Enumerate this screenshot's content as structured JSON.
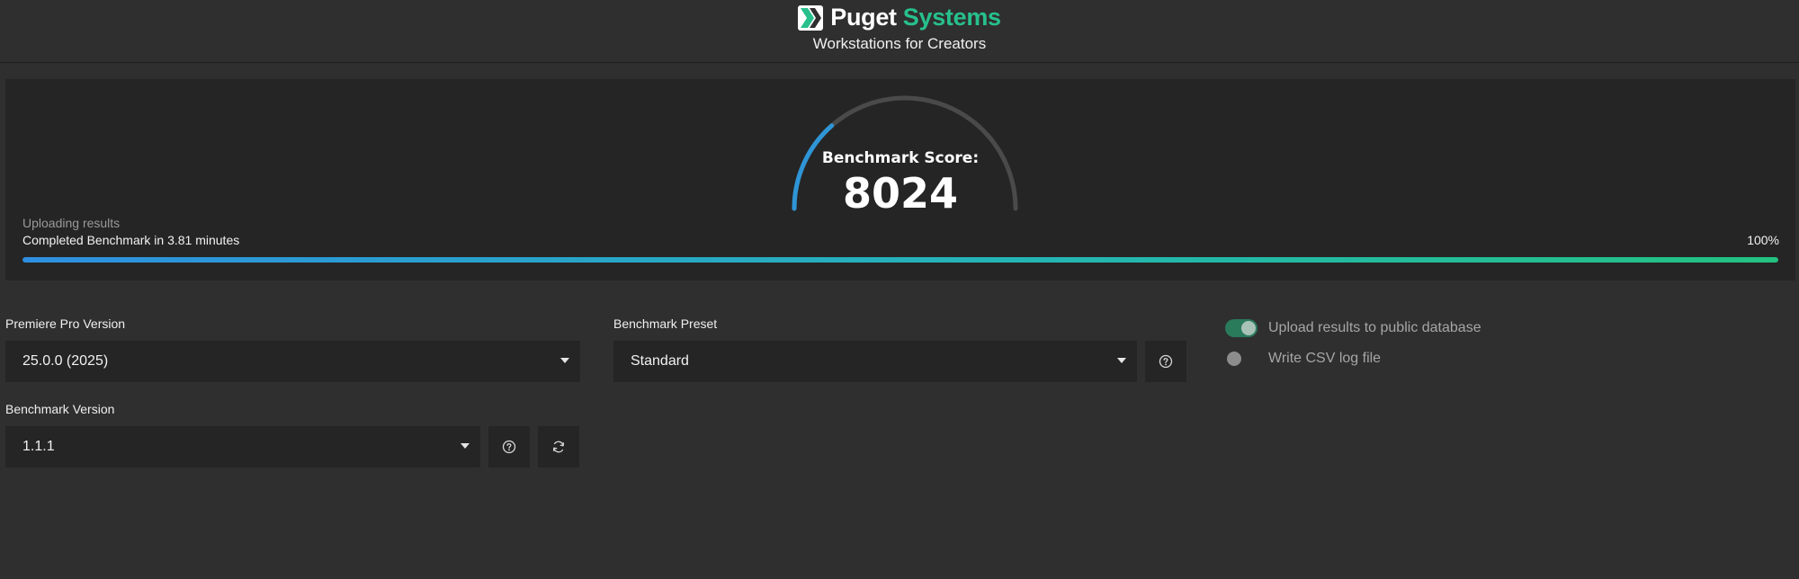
{
  "header": {
    "brand_first": "Puget",
    "brand_second": "Systems",
    "tagline": "Workstations for Creators",
    "logo_icon": "puget-chevron-logo-icon"
  },
  "result": {
    "score_label": "Benchmark Score:",
    "score_value": "8024",
    "gauge_fraction": 0.27,
    "status_line": "Uploading results",
    "completed_line": "Completed Benchmark in 3.81 minutes",
    "progress_text": "100%",
    "progress_fraction": 1.0
  },
  "settings": {
    "premiere_label": "Premiere Pro Version",
    "premiere_value": "25.0.0 (2025)",
    "preset_label": "Benchmark Preset",
    "preset_value": "Standard",
    "benchmark_version_label": "Benchmark Version",
    "benchmark_version_value": "1.1.1"
  },
  "options": {
    "upload_label": "Upload results to public database",
    "upload_on": true,
    "csv_label": "Write CSV log file",
    "csv_on": false
  },
  "colors": {
    "accent_green": "#27c08c",
    "accent_blue": "#2e95d6",
    "background": "#2f2f2f",
    "panel": "#252525"
  }
}
